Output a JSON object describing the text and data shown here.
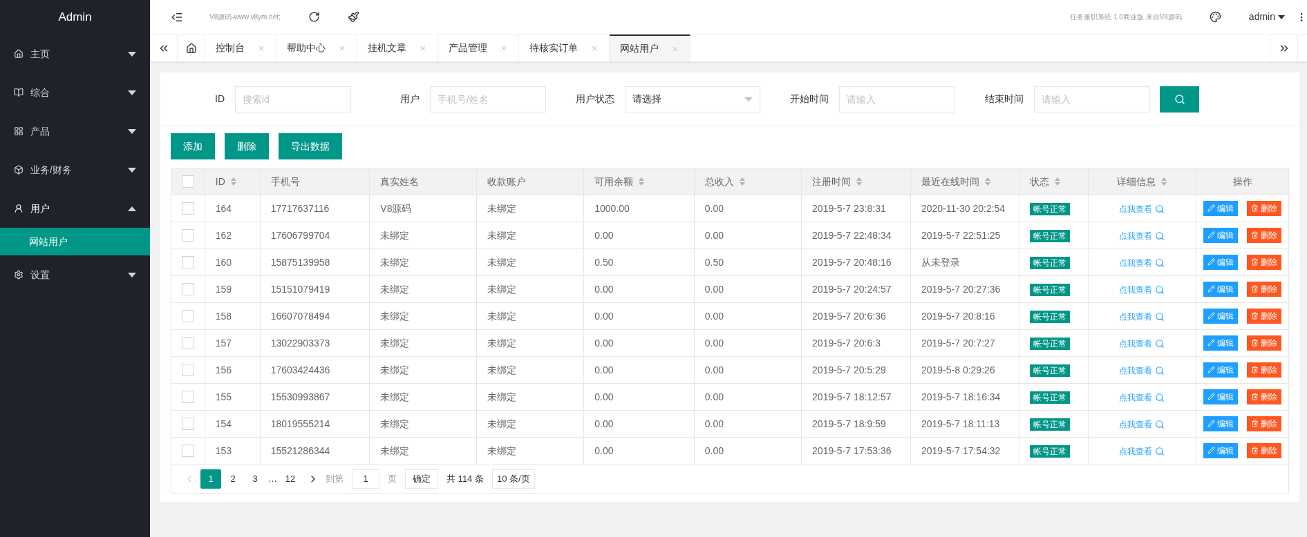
{
  "brand": "Admin",
  "sidebar": {
    "items": [
      {
        "label": "主页",
        "expanded": false
      },
      {
        "label": "综合",
        "expanded": false
      },
      {
        "label": "产品",
        "expanded": false
      },
      {
        "label": "业务/财务",
        "expanded": false
      },
      {
        "label": "用户",
        "expanded": true,
        "children": [
          {
            "label": "网站用户",
            "selected": true
          }
        ]
      },
      {
        "label": "设置",
        "expanded": false
      }
    ]
  },
  "header": {
    "site_text": "V8源码-www.v8ym.net;",
    "system_text": "任务兼职系统 1.0商业版 来自V8源码",
    "user": "admin"
  },
  "tabs": [
    {
      "label": "控制台",
      "selected": false
    },
    {
      "label": "帮助中心",
      "selected": false
    },
    {
      "label": "挂机文章",
      "selected": false
    },
    {
      "label": "产品管理",
      "selected": false
    },
    {
      "label": "待核实订单",
      "selected": false
    },
    {
      "label": "网站用户",
      "selected": true
    }
  ],
  "filters": [
    {
      "kind": "input",
      "label": "ID",
      "placeholder": "搜索id"
    },
    {
      "kind": "input",
      "label": "用户",
      "placeholder": "手机号/姓名"
    },
    {
      "kind": "select",
      "label": "用户状态",
      "value": "请选择"
    },
    {
      "kind": "input",
      "label": "开始时间",
      "placeholder": "请输入"
    },
    {
      "kind": "input",
      "label": "结束时间",
      "placeholder": "请输入"
    }
  ],
  "actions": [
    "添加",
    "删除",
    "导出数据"
  ],
  "table": {
    "select_all_checked": false,
    "columns": [
      {
        "label": "ID",
        "sortable": true
      },
      {
        "label": "手机号",
        "sortable": false
      },
      {
        "label": "真实姓名",
        "sortable": false
      },
      {
        "label": "收款账户",
        "sortable": false
      },
      {
        "label": "可用余额",
        "sortable": true
      },
      {
        "label": "总收入",
        "sortable": true
      },
      {
        "label": "注册时间",
        "sortable": true
      },
      {
        "label": "最近在线时间",
        "sortable": true
      },
      {
        "label": "状态",
        "sortable": true
      },
      {
        "label": "详细信息",
        "sortable": true
      },
      {
        "label": "操作",
        "sortable": false
      }
    ],
    "rows": [
      {
        "checked": false,
        "cells": [
          "164",
          "17717637116",
          "V8源码",
          "未绑定",
          "1000.00",
          "0.00",
          "2019-5-7 23:8:31",
          "2020-11-30 20:2:54"
        ],
        "status": "帐号正常",
        "detail": "点我查看",
        "edit": "编辑",
        "delete": "删除"
      },
      {
        "checked": false,
        "cells": [
          "162",
          "17606799704",
          "未绑定",
          "未绑定",
          "0.00",
          "0.00",
          "2019-5-7 22:48:34",
          "2019-5-7 22:51:25"
        ],
        "status": "帐号正常",
        "detail": "点我查看",
        "edit": "编辑",
        "delete": "删除"
      },
      {
        "checked": false,
        "cells": [
          "160",
          "15875139958",
          "未绑定",
          "未绑定",
          "0.50",
          "0.50",
          "2019-5-7 20:48:16",
          "从未登录"
        ],
        "status": "帐号正常",
        "detail": "点我查看",
        "edit": "编辑",
        "delete": "删除"
      },
      {
        "checked": false,
        "cells": [
          "159",
          "15151079419",
          "未绑定",
          "未绑定",
          "0.00",
          "0.00",
          "2019-5-7 20:24:57",
          "2019-5-7 20:27:36"
        ],
        "status": "帐号正常",
        "detail": "点我查看",
        "edit": "编辑",
        "delete": "删除"
      },
      {
        "checked": false,
        "cells": [
          "158",
          "16607078494",
          "未绑定",
          "未绑定",
          "0.00",
          "0.00",
          "2019-5-7 20:6:36",
          "2019-5-7 20:8:16"
        ],
        "status": "帐号正常",
        "detail": "点我查看",
        "edit": "编辑",
        "delete": "删除"
      },
      {
        "checked": false,
        "cells": [
          "157",
          "13022903373",
          "未绑定",
          "未绑定",
          "0.00",
          "0.00",
          "2019-5-7 20:6:3",
          "2019-5-7 20:7:27"
        ],
        "status": "帐号正常",
        "detail": "点我查看",
        "edit": "编辑",
        "delete": "删除"
      },
      {
        "checked": false,
        "cells": [
          "156",
          "17603424436",
          "未绑定",
          "未绑定",
          "0.00",
          "0.00",
          "2019-5-7 20:5:29",
          "2019-5-8 0:29:26"
        ],
        "status": "帐号正常",
        "detail": "点我查看",
        "edit": "编辑",
        "delete": "删除"
      },
      {
        "checked": false,
        "cells": [
          "155",
          "15530993867",
          "未绑定",
          "未绑定",
          "0.00",
          "0.00",
          "2019-5-7 18:12:57",
          "2019-5-7 18:16:34"
        ],
        "status": "帐号正常",
        "detail": "点我查看",
        "edit": "编辑",
        "delete": "删除"
      },
      {
        "checked": false,
        "cells": [
          "154",
          "18019555214",
          "未绑定",
          "未绑定",
          "0.00",
          "0.00",
          "2019-5-7 18:9:59",
          "2019-5-7 18:11:13"
        ],
        "status": "帐号正常",
        "detail": "点我查看",
        "edit": "编辑",
        "delete": "删除"
      },
      {
        "checked": false,
        "cells": [
          "153",
          "15521286344",
          "未绑定",
          "未绑定",
          "0.00",
          "0.00",
          "2019-5-7 17:53:36",
          "2019-5-7 17:54:32"
        ],
        "status": "帐号正常",
        "detail": "点我查看",
        "edit": "编辑",
        "delete": "删除"
      }
    ]
  },
  "pagination": {
    "pages": [
      {
        "label": "1",
        "selected": true
      },
      {
        "label": "2",
        "selected": false
      },
      {
        "label": "3",
        "selected": false
      },
      {
        "label": "…",
        "kind": "ellipsis"
      },
      {
        "label": "12",
        "selected": false
      }
    ],
    "goto_label": "到第",
    "goto_value": "1",
    "page_unit": "页",
    "confirm": "确定",
    "total": "共 114 条",
    "page_size": "10 条/页"
  }
}
